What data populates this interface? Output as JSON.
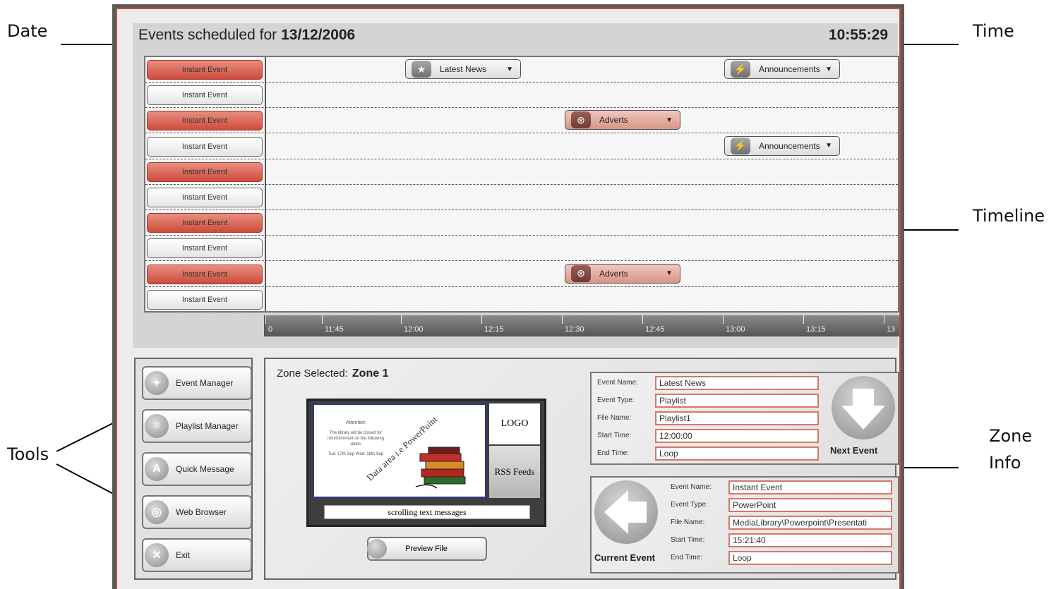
{
  "annotations": {
    "date": "Date",
    "time": "Time",
    "timeline": "Timeline",
    "tools": "Tools",
    "zone_info_line1": "Zone",
    "zone_info_line2": "Info"
  },
  "header": {
    "prefix": "Events scheduled for",
    "date": "13/12/2006",
    "time": "10:55:29"
  },
  "instant_events": [
    {
      "label": "Instant Event",
      "state": "active"
    },
    {
      "label": "Instant Event",
      "state": "inactive"
    },
    {
      "label": "Instant Event",
      "state": "active"
    },
    {
      "label": "Instant Event",
      "state": "inactive"
    },
    {
      "label": "Instant Event",
      "state": "active"
    },
    {
      "label": "Instant Event",
      "state": "inactive"
    },
    {
      "label": "Instant Event",
      "state": "active"
    },
    {
      "label": "Instant Event",
      "state": "inactive"
    },
    {
      "label": "Instant Event",
      "state": "active"
    },
    {
      "label": "Instant Event",
      "state": "inactive"
    }
  ],
  "timeline_events": [
    {
      "row": 0,
      "label": "Latest News",
      "icon": "star-icon",
      "style": "grey"
    },
    {
      "row": 0,
      "label": "Announcements",
      "icon": "lightning-icon",
      "style": "grey"
    },
    {
      "row": 2,
      "label": "Adverts",
      "icon": "film-reel-icon",
      "style": "pink"
    },
    {
      "row": 3,
      "label": "Announcements",
      "icon": "lightning-icon",
      "style": "grey"
    },
    {
      "row": 8,
      "label": "Adverts",
      "icon": "film-reel-icon",
      "style": "pink"
    }
  ],
  "timeline_ticks": [
    "0",
    "11:45",
    "12:00",
    "12:15",
    "12:30",
    "12:45",
    "13:00",
    "13:15",
    "13"
  ],
  "tools": [
    {
      "label": "Event Manager",
      "icon": "event-manager-icon"
    },
    {
      "label": "Playlist Manager",
      "icon": "playlist-icon"
    },
    {
      "label": "Quick Message",
      "icon": "quick-message-icon"
    },
    {
      "label": "Web Browser",
      "icon": "globe-icon"
    },
    {
      "label": "Exit",
      "icon": "exit-icon"
    }
  ],
  "zone": {
    "label": "Zone Selected:",
    "value": "Zone 1",
    "preview": {
      "slide_heading": "Attention",
      "slide_text": "The library will be closed for refurbishment on the following dates",
      "slide_dates": "Tue: 17th Sep  Wed: 18th Sep",
      "slide_diagonal": "Data area i.e PowerPoint",
      "logo": "LOGO",
      "rss": "RSS Feeds",
      "ticker": "scrolling text messages"
    },
    "preview_button": "Preview File"
  },
  "next_event": {
    "title": "Next Event",
    "fields": [
      {
        "label": "Event Name:",
        "value": "Latest News"
      },
      {
        "label": "Event Type:",
        "value": "Playlist"
      },
      {
        "label": "File Name:",
        "value": "Playlist1"
      },
      {
        "label": "Start Time:",
        "value": "12:00:00"
      },
      {
        "label": "End Time:",
        "value": "Loop"
      }
    ]
  },
  "current_event": {
    "title": "Current Event",
    "fields": [
      {
        "label": "Event Name:",
        "value": "Instant Event"
      },
      {
        "label": "Event Type:",
        "value": "PowerPoint"
      },
      {
        "label": "File Name:",
        "value": "MediaLibrary\\Powerpoint\\Presentati"
      },
      {
        "label": "Start Time:",
        "value": "15:21:40"
      },
      {
        "label": "End Time:",
        "value": "Loop"
      }
    ]
  },
  "colors": {
    "accent_red": "#cd4b3b",
    "frame": "#5a5a5a",
    "field_border": "#d4786a"
  }
}
